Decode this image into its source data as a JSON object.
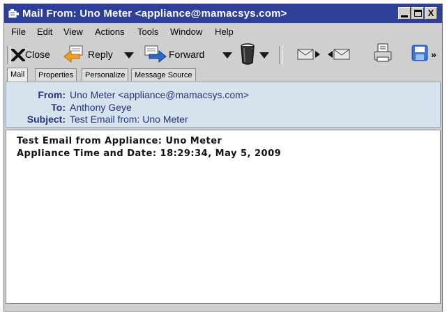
{
  "window": {
    "title": "Mail From: Uno Meter <appliance@mamacsys.com>",
    "controls": [
      "minimize",
      "maximize",
      "close"
    ],
    "close_glyph": "X"
  },
  "menu": [
    "File",
    "Edit",
    "View",
    "Actions",
    "Tools",
    "Window",
    "Help"
  ],
  "toolbar": {
    "close_label": "Close",
    "reply_label": "Reply",
    "forward_label": "Forward",
    "more_glyph": "»"
  },
  "tabs": [
    "Mail",
    "Properties",
    "Personalize",
    "Message Source"
  ],
  "active_tab": "Mail",
  "header": {
    "from_label": "From:",
    "from_value": "Uno Meter <appliance@mamacsys.com>",
    "to_label": "To:",
    "to_value": "Anthony Geye",
    "subject_label": "Subject:",
    "subject_value": "Test Email from: Uno Meter"
  },
  "body": {
    "lines": [
      "Test Email from Appliance: Uno Meter",
      "Appliance Time and Date: 18:29:34, May 5, 2009"
    ]
  },
  "colors": {
    "titlebar": "#2e3f9a",
    "header_bg": "#d6e2ec",
    "header_text": "#27337a",
    "window_bg": "#cfcfcf"
  }
}
